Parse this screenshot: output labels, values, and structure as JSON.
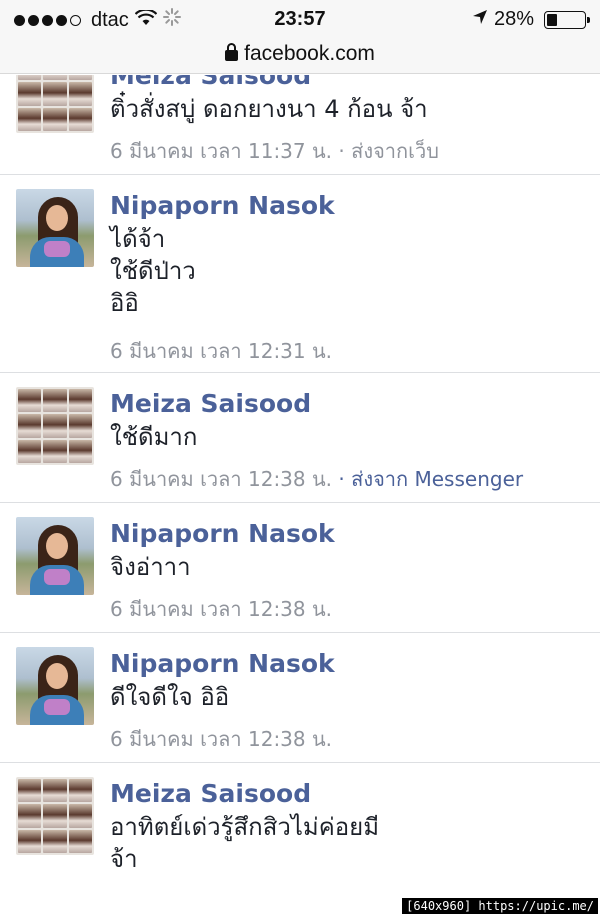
{
  "status": {
    "carrier": "dtac",
    "time": "23:57",
    "battery": "28%",
    "battery_level": 0.28
  },
  "browser": {
    "url": "facebook.com"
  },
  "messages": [
    {
      "name": "Meiza Saisood",
      "lines": [
        "ติ๋วสั่งสบู่ ดอกยางนา 4 ก้อน จ้า"
      ],
      "time": "6 มีนาคม เวลา 11:37 น.",
      "source": "· ส่งจากเว็บ"
    },
    {
      "name": "Nipaporn Nasok",
      "lines": [
        "ได้จ้า",
        "ใช้ดีป่าว",
        "อิอิ"
      ],
      "time": "6 มีนาคม เวลา 12:31 น.",
      "source": ""
    },
    {
      "name": "Meiza Saisood",
      "lines": [
        "ใช้ดีมาก"
      ],
      "time": "6 มีนาคม เวลา 12:38 น.",
      "source": "· ส่งจาก Messenger"
    },
    {
      "name": "Nipaporn Nasok",
      "lines": [
        "จิงอ่าาา"
      ],
      "time": "6 มีนาคม เวลา 12:38 น.",
      "source": ""
    },
    {
      "name": "Nipaporn Nasok",
      "lines": [
        "ดีใจดีใจ อิอิ"
      ],
      "time": "6 มีนาคม เวลา 12:38 น.",
      "source": ""
    },
    {
      "name": "Meiza Saisood",
      "lines": [
        "อาทิตย์เด่วรู้สึกสิวไม่ค่อยมี",
        "จ้า"
      ],
      "time": "",
      "source": ""
    }
  ],
  "watermark": "[640x960] https://upic.me/"
}
